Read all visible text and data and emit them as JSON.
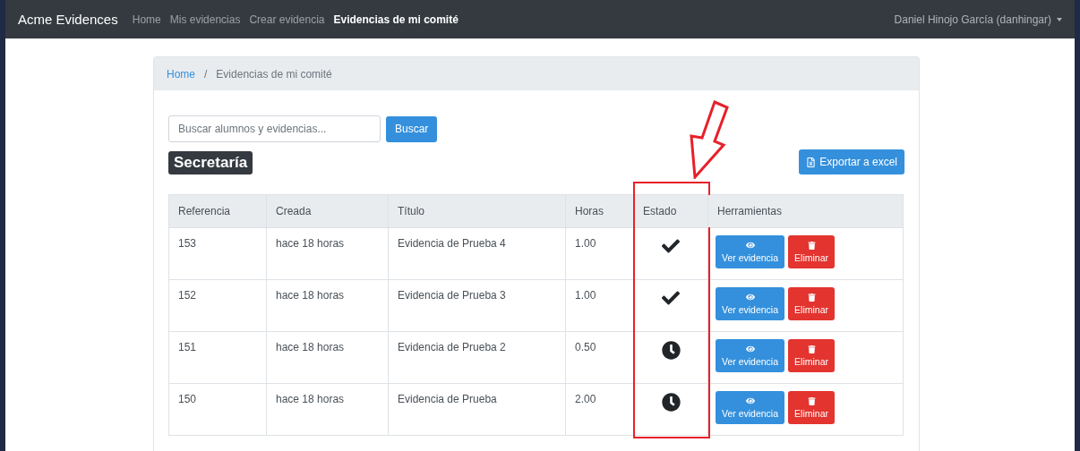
{
  "navbar": {
    "brand": "Acme Evidences",
    "links": [
      {
        "label": "Home",
        "selected": false
      },
      {
        "label": "Mis evidencias",
        "selected": false
      },
      {
        "label": "Crear evidencia",
        "selected": false
      },
      {
        "label": "Evidencias de mi comité",
        "selected": true
      }
    ],
    "user": "Daniel Hinojo García (danhingar)"
  },
  "breadcrumb": {
    "separator": "/",
    "items": [
      {
        "label": "Home",
        "active": false
      },
      {
        "label": "Evidencias de mi comité",
        "active": true
      }
    ]
  },
  "search": {
    "placeholder": "Buscar alumnos y evidencias...",
    "button": "Buscar"
  },
  "committee": "Secretaría",
  "export_button": "Exportar a excel",
  "table": {
    "columns": [
      {
        "label": "Referencia",
        "highlighted": false
      },
      {
        "label": "Creada",
        "highlighted": false
      },
      {
        "label": "Título",
        "highlighted": false
      },
      {
        "label": "Horas",
        "highlighted": false
      },
      {
        "label": "Estado",
        "highlighted": true
      },
      {
        "label": "Herramientas",
        "highlighted": false
      }
    ],
    "rows": [
      {
        "reference": "153",
        "created": "hace 18 horas",
        "title": "Evidencia de Prueba 4",
        "hours": "1.00",
        "approved": true,
        "view": "Ver evidencia",
        "delete": "Eliminar"
      },
      {
        "reference": "152",
        "created": "hace 18 horas",
        "title": "Evidencia de Prueba 3",
        "hours": "1.00",
        "approved": true,
        "view": "Ver evidencia",
        "delete": "Eliminar"
      },
      {
        "reference": "151",
        "created": "hace 18 horas",
        "title": "Evidencia de Prueba 2",
        "hours": "0.50",
        "approved": false,
        "view": "Ver evidencia",
        "delete": "Eliminar"
      },
      {
        "reference": "150",
        "created": "hace 18 horas",
        "title": "Evidencia de Prueba",
        "hours": "2.00",
        "approved": false,
        "view": "Ver evidencia",
        "delete": "Eliminar"
      }
    ]
  }
}
